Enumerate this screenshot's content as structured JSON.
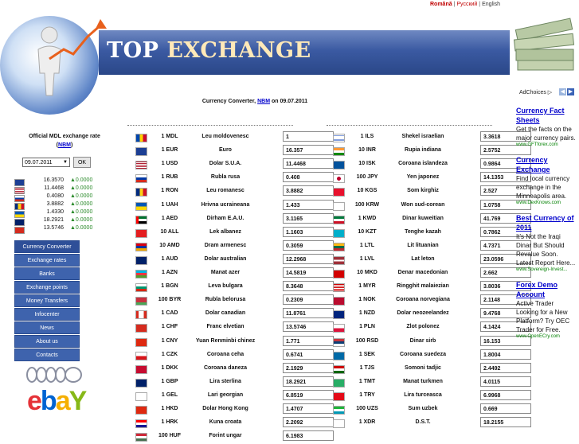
{
  "languages": [
    "Română",
    "Русский",
    "English"
  ],
  "site_title_part1": "TOP",
  "site_title_part2": "EXCHANGE",
  "subtitle": {
    "prefix": "Currency Converter,",
    "link": "NBM",
    "suffix": "on 09.07.2011"
  },
  "adchoices": "AdChoices",
  "official": {
    "label": "Official MDL exchange rate",
    "link": "NBM"
  },
  "date_value": "09.07.2011",
  "ok_label": "OK",
  "mini_rates": [
    {
      "flag": "eu",
      "value": "16.3570",
      "change": "0.0000"
    },
    {
      "flag": "us",
      "value": "11.4468",
      "change": "0.0000"
    },
    {
      "flag": "ru",
      "value": "0.4080",
      "change": "0.0000"
    },
    {
      "flag": "ro",
      "value": "3.8882",
      "change": "0.0000"
    },
    {
      "flag": "ua",
      "value": "1.4330",
      "change": "0.0000"
    },
    {
      "flag": "gb",
      "value": "18.2921",
      "change": "0.0000"
    },
    {
      "flag": "ch",
      "value": "13.5746",
      "change": "0.0000"
    }
  ],
  "menu": [
    "Currency Converter",
    "Exchange rates",
    "Banks",
    "Exchange points",
    "Money Transfers",
    "Infocenter",
    "News",
    "About us",
    "Contacts"
  ],
  "currencies_left": [
    {
      "flag": "md",
      "code": "1 MDL",
      "name": "Leu moldovenesc",
      "value": "1"
    },
    {
      "flag": "eu",
      "code": "1 EUR",
      "name": "Euro",
      "value": "16.357"
    },
    {
      "flag": "us",
      "code": "1 USD",
      "name": "Dolar S.U.A.",
      "value": "11.4468"
    },
    {
      "flag": "ru",
      "code": "1 RUB",
      "name": "Rubla rusa",
      "value": "0.408"
    },
    {
      "flag": "ro",
      "code": "1 RON",
      "name": "Leu romanesc",
      "value": "3.8882"
    },
    {
      "flag": "ua",
      "code": "1 UAH",
      "name": "Hrivna ucraineana",
      "value": "1.433"
    },
    {
      "flag": "ae",
      "code": "1 AED",
      "name": "Dirham E.A.U.",
      "value": "3.1165"
    },
    {
      "flag": "al",
      "code": "10 ALL",
      "name": "Lek albanez",
      "value": "1.1603"
    },
    {
      "flag": "am",
      "code": "10 AMD",
      "name": "Dram armenesc",
      "value": "0.3059"
    },
    {
      "flag": "au",
      "code": "1 AUD",
      "name": "Dolar australian",
      "value": "12.2968"
    },
    {
      "flag": "az",
      "code": "1 AZN",
      "name": "Manat azer",
      "value": "14.5819"
    },
    {
      "flag": "bg",
      "code": "1 BGN",
      "name": "Leva bulgara",
      "value": "8.3648"
    },
    {
      "flag": "by",
      "code": "100 BYR",
      "name": "Rubla belorusa",
      "value": "0.2309"
    },
    {
      "flag": "ca",
      "code": "1 CAD",
      "name": "Dolar canadian",
      "value": "11.8761"
    },
    {
      "flag": "ch",
      "code": "1 CHF",
      "name": "Franc elvetian",
      "value": "13.5746"
    },
    {
      "flag": "cn",
      "code": "1 CNY",
      "name": "Yuan Renminbi chinez",
      "value": "1.771"
    },
    {
      "flag": "cz",
      "code": "1 CZK",
      "name": "Coroana ceha",
      "value": "0.6741"
    },
    {
      "flag": "dk",
      "code": "1 DKK",
      "name": "Coroana daneza",
      "value": "2.1929"
    },
    {
      "flag": "gb",
      "code": "1 GBP",
      "name": "Lira sterlina",
      "value": "18.2921"
    },
    {
      "flag": "ge",
      "code": "1 GEL",
      "name": "Lari georgian",
      "value": "6.8519"
    },
    {
      "flag": "hk",
      "code": "1 HKD",
      "name": "Dolar Hong Kong",
      "value": "1.4707"
    },
    {
      "flag": "hr",
      "code": "1 HRK",
      "name": "Kuna croata",
      "value": "2.2092"
    },
    {
      "flag": "hu",
      "code": "100 HUF",
      "name": "Forint ungar",
      "value": "6.1983"
    }
  ],
  "currencies_right": [
    {
      "flag": "il",
      "code": "1 ILS",
      "name": "Shekel israelian",
      "value": "3.3618"
    },
    {
      "flag": "in",
      "code": "10 INR",
      "name": "Rupia indiana",
      "value": "2.5752"
    },
    {
      "flag": "is",
      "code": "10 ISK",
      "name": "Coroana islandeza",
      "value": "0.9864"
    },
    {
      "flag": "jp",
      "code": "100 JPY",
      "name": "Yen japonez",
      "value": "14.1353"
    },
    {
      "flag": "kg",
      "code": "10 KGS",
      "name": "Som kirghiz",
      "value": "2.527"
    },
    {
      "flag": "kr",
      "code": "100 KRW",
      "name": "Won sud-corean",
      "value": "1.0758"
    },
    {
      "flag": "kw",
      "code": "1 KWD",
      "name": "Dinar kuweitian",
      "value": "41.769"
    },
    {
      "flag": "kz",
      "code": "10 KZT",
      "name": "Tenghe kazah",
      "value": "0.7862"
    },
    {
      "flag": "lt",
      "code": "1 LTL",
      "name": "Lit lituanian",
      "value": "4.7371"
    },
    {
      "flag": "lv",
      "code": "1 LVL",
      "name": "Lat leton",
      "value": "23.0596"
    },
    {
      "flag": "mk",
      "code": "10 MKD",
      "name": "Denar macedonian",
      "value": "2.662"
    },
    {
      "flag": "my",
      "code": "1 MYR",
      "name": "Ringghit malaiezian",
      "value": "3.8036"
    },
    {
      "flag": "no",
      "code": "1 NOK",
      "name": "Coroana norvegiana",
      "value": "2.1148"
    },
    {
      "flag": "nz",
      "code": "1 NZD",
      "name": "Dolar neozeelandez",
      "value": "9.4768"
    },
    {
      "flag": "pl",
      "code": "1 PLN",
      "name": "Zlot polonez",
      "value": "4.1424"
    },
    {
      "flag": "rs",
      "code": "100 RSD",
      "name": "Dinar sirb",
      "value": "16.153"
    },
    {
      "flag": "se",
      "code": "1 SEK",
      "name": "Coroana suedeza",
      "value": "1.8004"
    },
    {
      "flag": "tj",
      "code": "1 TJS",
      "name": "Somoni tadjic",
      "value": "2.4492"
    },
    {
      "flag": "tm",
      "code": "1 TMT",
      "name": "Manat turkmen",
      "value": "4.0115"
    },
    {
      "flag": "tr",
      "code": "1 TRY",
      "name": "Lira turceasca",
      "value": "6.9968"
    },
    {
      "flag": "uz",
      "code": "100 UZS",
      "name": "Sum uzbek",
      "value": "0.669"
    },
    {
      "flag": "xdr",
      "code": "1 XDR",
      "name": "D.S.T.",
      "value": "18.2155"
    }
  ],
  "ads": [
    {
      "head": "Currency Fact Sheets",
      "body": "Get the facts on the major currency pairs.",
      "url": "www.GFTforex.com"
    },
    {
      "head": "Currency Exchange",
      "body": "Find local currency exchange in the Minneapolis area.",
      "url": "www.DexKnows.com"
    },
    {
      "head": "Best Currency of 2011",
      "body": "It's Not the Iraqi Dinar But Should Revalue Soon. Latest Report Here...",
      "url": "www.Sovereign-Invest..."
    },
    {
      "head": "Forex Demo Account",
      "body": "Active Trader Looking for a New Platform? Try OEC Trader for Free.",
      "url": "www.OpenECry.com"
    }
  ]
}
